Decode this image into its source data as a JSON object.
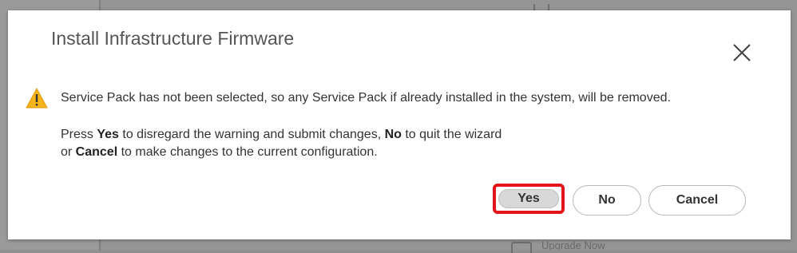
{
  "dialog": {
    "title": "Install Infrastructure Firmware",
    "warning_message": "Service Pack has not been selected, so any Service Pack if already installed in the system, will be removed.",
    "instructions": {
      "press": "Press ",
      "yes": "Yes",
      "after_yes": " to disregard the warning and submit changes, ",
      "no": "No",
      "after_no": " to quit the wizard",
      "or": "or ",
      "cancel": "Cancel",
      "after_cancel": " to make changes to the current configuration."
    },
    "buttons": {
      "yes": "Yes",
      "no": "No",
      "cancel": "Cancel"
    }
  },
  "background": {
    "faded_text": "Upgrade Now"
  },
  "colors": {
    "warning_icon": "#f5b41b",
    "highlight": "#e3151a"
  }
}
